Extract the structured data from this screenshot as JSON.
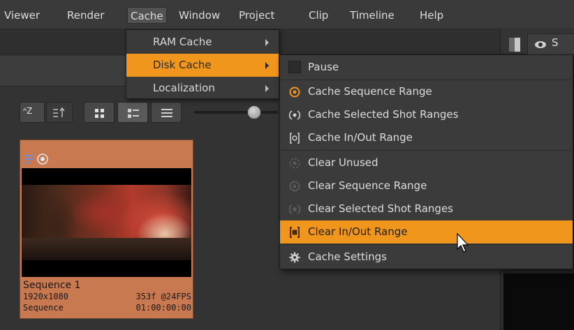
{
  "menubar": {
    "items": [
      "Viewer",
      "Render",
      "Cache",
      "Window",
      "Project",
      "Clip",
      "Timeline",
      "Help"
    ],
    "active": "Cache"
  },
  "right_panel": {
    "tab_label": "S"
  },
  "cache_menu": {
    "items": [
      {
        "label": "RAM Cache",
        "submenu": true
      },
      {
        "label": "Disk Cache",
        "submenu": true,
        "selected": true
      },
      {
        "label": "Localization",
        "submenu": true
      }
    ]
  },
  "disk_cache_menu": {
    "items": [
      {
        "label": "Pause",
        "icon": "checkbox"
      },
      {
        "label": "Cache Sequence Range",
        "icon": "orange-target-icon"
      },
      {
        "label": "Cache Selected Shot Ranges",
        "icon": "selected-range-icon"
      },
      {
        "label": "Cache In/Out Range",
        "icon": "inout-range-icon"
      },
      {
        "label": "Clear Unused",
        "icon": "clear-unused-icon"
      },
      {
        "label": "Clear Sequence Range",
        "icon": "clear-sequence-icon"
      },
      {
        "label": "Clear Selected Shot Ranges",
        "icon": "clear-selected-icon"
      },
      {
        "label": "Clear In/Out Range",
        "icon": "clear-inout-icon",
        "selected": true
      },
      {
        "label": "Cache Settings",
        "icon": "gear-icon"
      }
    ]
  },
  "toolbar": {
    "sort_az_label": "ᴬZ",
    "icons": [
      "sort-az-icon",
      "sort-order-icon",
      "grid-view-icon",
      "detail-view-icon",
      "list-view-icon"
    ],
    "zoom_slider_level": 0.65
  },
  "clip": {
    "name": "Sequence 1",
    "resolution": "1920x1080",
    "frames": "353f @24FPS",
    "type": "Sequence",
    "timecode": "01:00:00:00"
  },
  "colors": {
    "accent": "#f0961c",
    "card": "#c9794f",
    "menu_bg": "#3b3b3b"
  }
}
